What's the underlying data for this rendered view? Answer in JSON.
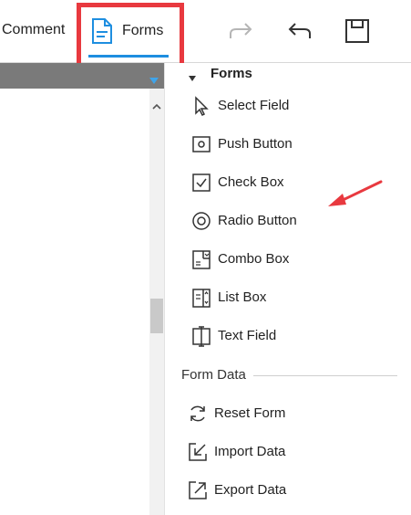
{
  "toolbar": {
    "comment_label": "Comment",
    "forms_label": "Forms",
    "accent": "#1e8ee0",
    "highlight_color": "#e8393f",
    "icons": [
      "forms-icon",
      "redo-icon",
      "undo-icon",
      "save-icon"
    ]
  },
  "panel": {
    "section_title": "Forms",
    "form_items": [
      {
        "label": "Select Field",
        "icon": "cursor-icon"
      },
      {
        "label": "Push Button",
        "icon": "push-button-icon"
      },
      {
        "label": "Check Box",
        "icon": "checkbox-icon"
      },
      {
        "label": "Radio Button",
        "icon": "radio-button-icon"
      },
      {
        "label": "Combo Box",
        "icon": "combo-box-icon"
      },
      {
        "label": "List Box",
        "icon": "list-box-icon"
      },
      {
        "label": "Text Field",
        "icon": "text-field-icon"
      }
    ],
    "data_group_title": "Form Data",
    "data_items": [
      {
        "label": "Reset Form",
        "icon": "reset-icon"
      },
      {
        "label": "Import Data",
        "icon": "import-icon"
      },
      {
        "label": "Export Data",
        "icon": "export-icon"
      }
    ]
  },
  "annotation": {
    "color": "#e8393f"
  }
}
